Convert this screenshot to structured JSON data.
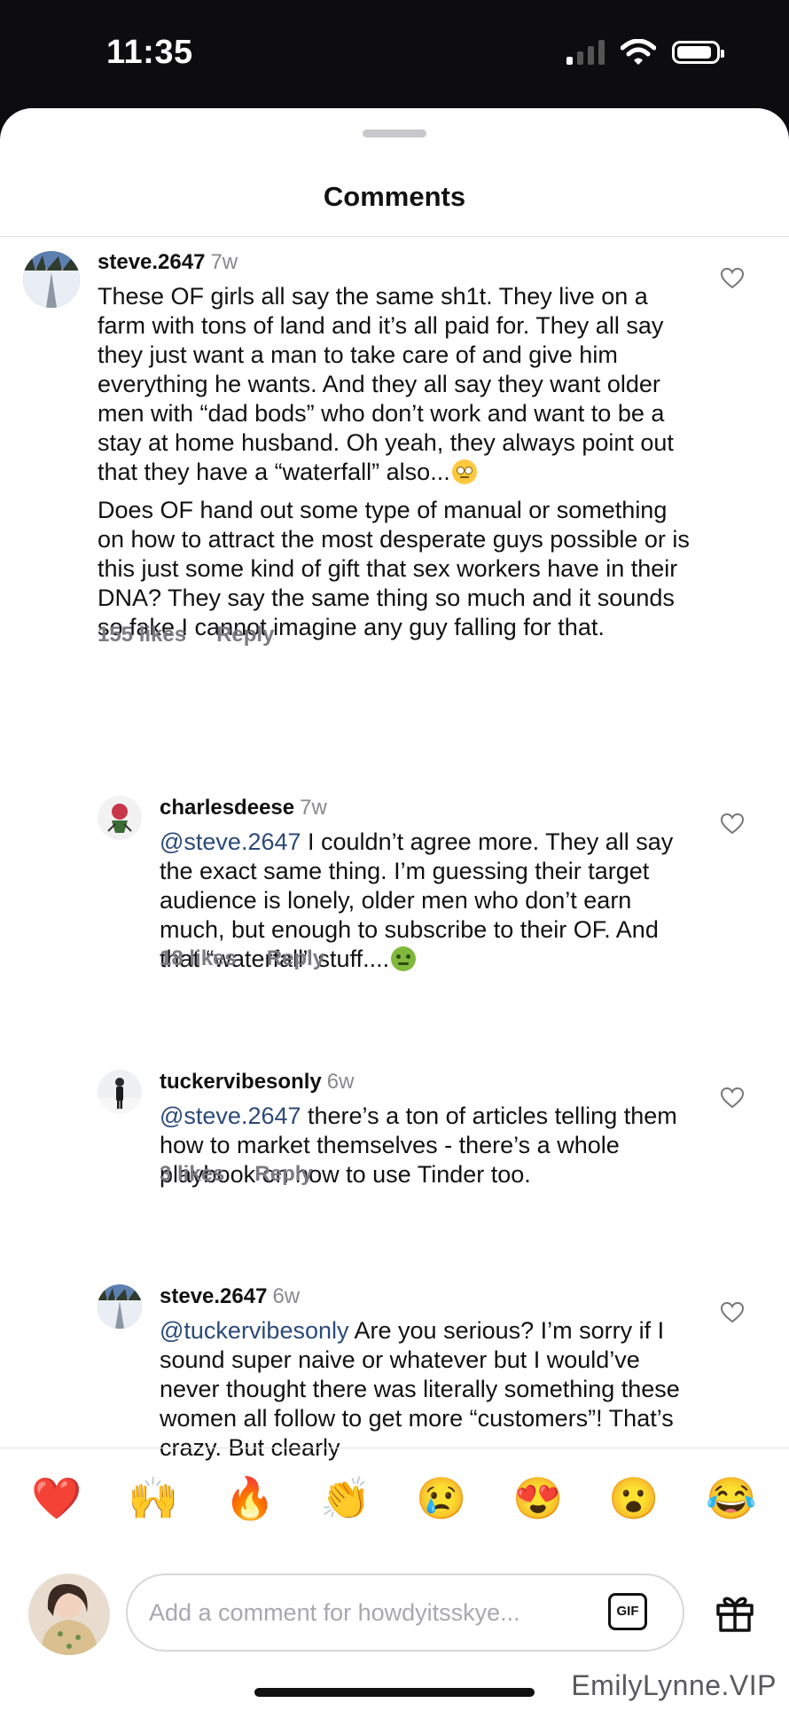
{
  "status_bar": {
    "time": "11:35"
  },
  "sheet": {
    "title": "Comments"
  },
  "comments": [
    {
      "user": "steve.2647",
      "ago": "7w",
      "paragraphs": [
        "These OF girls all say the same sh1t. They live on a farm with tons of land and it’s all paid for. They all say they just want a man to take care of and give him everything he wants. And they all say they want older men with “dad bods” who don’t work and want to be a stay at home husband. Oh yeah, they always point out that they have a “waterfall” also...",
        "Does OF hand out some type of manual or something on how to attract the most desperate guys possible or is this just some kind of gift that sex workers have in their DNA? They say the same thing so much and it sounds so fake I cannot imagine any guy falling for that."
      ],
      "emoji": "eye-roll-emoji",
      "likes": "155 likes",
      "reply": "Reply"
    },
    {
      "user": "charlesdeese",
      "ago": "7w",
      "mention": "@steve.2647",
      "text": " I couldn’t agree more. They all say the exact same thing. I’m guessing their target audience is lonely, older men who don’t earn much, but enough to subscribe to their OF. And that “waterfall” stuff....",
      "emoji": "nauseated-emoji",
      "likes": "18 likes",
      "reply": "Reply"
    },
    {
      "user": "tuckervibesonly",
      "ago": "6w",
      "mention": "@steve.2647",
      "text": " there’s a ton of articles telling them how to market themselves - there’s a whole playbook on how to use Tinder too.",
      "likes": "3 likes",
      "reply": "Reply"
    },
    {
      "user": "steve.2647",
      "ago": "6w",
      "mention": "@tuckervibesonly",
      "text": " Are you serious? I’m sorry if I sound super naive or whatever but I would’ve never thought there was literally something these women all follow to get more “customers”! That’s crazy. But clearly"
    }
  ],
  "reactions": [
    "❤️",
    "🙌",
    "🔥",
    "👏",
    "😢",
    "😍",
    "😮",
    "😂"
  ],
  "composer": {
    "placeholder": "Add a comment for howdyitsskye...",
    "gif_label": "GIF"
  },
  "watermark": "EmilyLynne.VIP",
  "icons": {
    "heart": "heart-outline-icon",
    "gift": "gift-icon",
    "wifi": "wifi-icon",
    "battery": "battery-icon",
    "signal": "cellular-signal-icon"
  }
}
